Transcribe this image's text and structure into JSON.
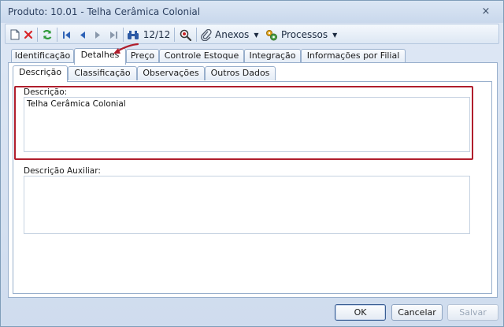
{
  "window": {
    "title": "Produto: 10.01 - Telha Cerâmica Colonial",
    "close_glyph": "×"
  },
  "toolbar": {
    "record_position": "12/12",
    "attachments_label": "Anexos",
    "processes_label": "Processos",
    "dropdown_glyph": "▼",
    "icons": [
      "new-document-icon",
      "delete-icon",
      "refresh-icon",
      "first-record-icon",
      "previous-record-icon",
      "next-record-icon",
      "last-record-icon",
      "find-icon",
      "zoom-icon",
      "attachments-icon",
      "processes-icon"
    ]
  },
  "tabs": [
    {
      "label": "Identificação"
    },
    {
      "label": "Detalhes"
    },
    {
      "label": "Preço"
    },
    {
      "label": "Controle Estoque"
    },
    {
      "label": "Integração"
    },
    {
      "label": "Informações por Filial"
    }
  ],
  "subtabs": [
    {
      "label": "Descrição"
    },
    {
      "label": "Classificação"
    },
    {
      "label": "Observações"
    },
    {
      "label": "Outros Dados"
    }
  ],
  "form": {
    "description_label": "Descrição:",
    "description_value": "Telha Cerâmica Colonial",
    "aux_description_label": "Descrição Auxiliar:",
    "aux_description_value": ""
  },
  "buttons": {
    "ok_label": "OK",
    "cancel_label": "Cancelar",
    "save_label": "Salvar"
  },
  "colors": {
    "highlight": "#b01e2c",
    "accent": "#3a5e93"
  }
}
